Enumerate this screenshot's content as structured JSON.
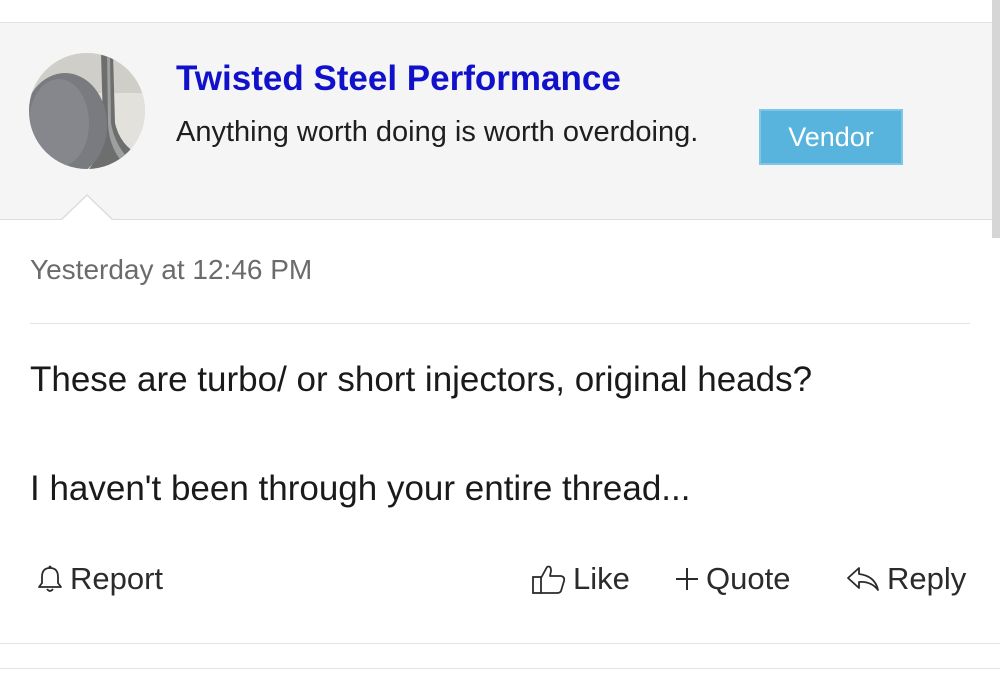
{
  "post": {
    "user": {
      "name": "Twisted Steel Performance",
      "title": "Anything worth doing is worth overdoing.",
      "badge": "Vendor",
      "avatar_icon": "valve-photo-avatar"
    },
    "timestamp": "Yesterday at 12:46 PM",
    "message": [
      "These are turbo/ or short injectors, original heads?",
      "I haven't been through your entire thread..."
    ],
    "actions": {
      "report": {
        "label": "Report",
        "icon": "bell-icon"
      },
      "like": {
        "label": "Like",
        "icon": "thumbs-up-icon"
      },
      "quote": {
        "label": "Quote",
        "icon": "plus-icon"
      },
      "reply": {
        "label": "Reply",
        "icon": "reply-arrow-icon"
      }
    }
  },
  "colors": {
    "username": "#1111cc",
    "vendor_badge": "#58b4dd",
    "header_background": "#f5f5f5",
    "muted_text": "#6b6b6b"
  }
}
